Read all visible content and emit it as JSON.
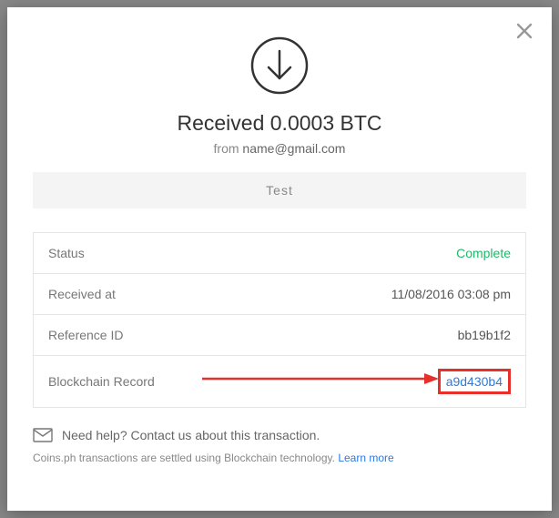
{
  "header": {
    "title": "Received 0.0003 BTC",
    "from_prefix": "from ",
    "from_email": "name@gmail.com",
    "test_label": "Test"
  },
  "details": {
    "rows": [
      {
        "label": "Status",
        "value": "Complete",
        "kind": "status"
      },
      {
        "label": "Received at",
        "value": "11/08/2016 03:08 pm",
        "kind": "text"
      },
      {
        "label": "Reference ID",
        "value": "bb19b1f2",
        "kind": "text"
      },
      {
        "label": "Blockchain Record",
        "value": "a9d430b4",
        "kind": "link"
      }
    ]
  },
  "help": {
    "text": "Need help? Contact us about this transaction."
  },
  "footer": {
    "note": "Coins.ph transactions are settled using Blockchain technology. ",
    "learn_more": "Learn more"
  },
  "colors": {
    "status_complete": "#1db96b",
    "link": "#2a7ae2",
    "annotation": "#e8302a"
  }
}
